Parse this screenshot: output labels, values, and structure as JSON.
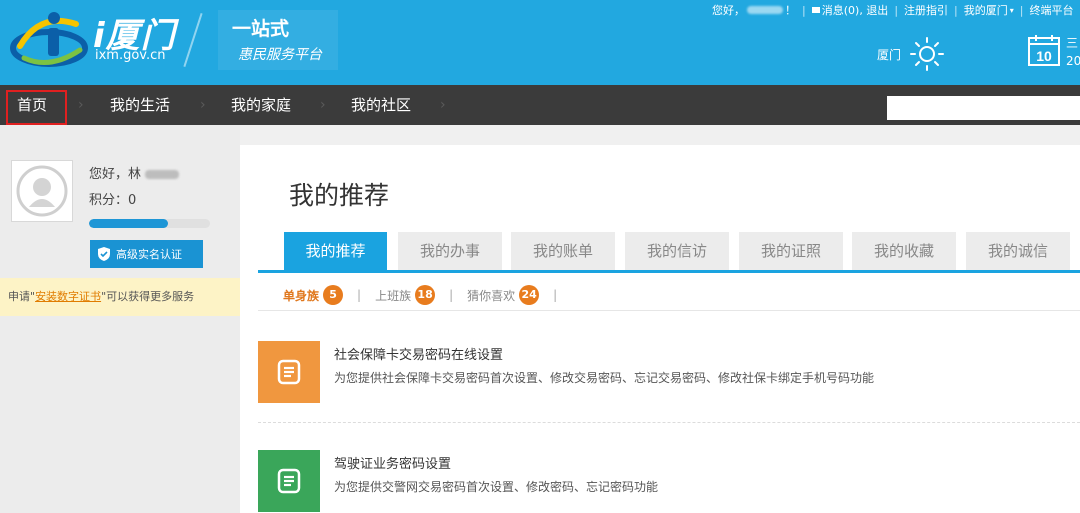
{
  "header": {
    "site_name": "i厦门",
    "site_url": "ixm.gov.cn",
    "slogan_line1": "一站式",
    "slogan_line2": "惠民服务平台",
    "greeting": "您好，",
    "greeting_suffix": "！",
    "messages": "消息(0)",
    "logout": "退出",
    "register_guide": "注册指引",
    "my_xiamen": "我的厦门",
    "terminal": "终端平台",
    "weather_city": "厦门",
    "date_day": "10",
    "date_line1": "三",
    "date_line2": "20"
  },
  "nav": {
    "items": [
      "首页",
      "我的生活",
      "我的家庭",
      "我的社区"
    ],
    "search_placeholder": ""
  },
  "user": {
    "greeting": "您好，林",
    "points": "积分：0",
    "progress": 0.65,
    "verify_label": "高级实名认证"
  },
  "notice": {
    "prefix": "申请\"",
    "link": "安装数字证书",
    "suffix": "\"可以获得更多服务"
  },
  "main": {
    "title": "我的推荐",
    "tabs": [
      "我的推荐",
      "我的办事",
      "我的账单",
      "我的信访",
      "我的证照",
      "我的收藏",
      "我的诚信"
    ],
    "sub_tabs": [
      {
        "label": "单身族",
        "count": "5"
      },
      {
        "label": "上班族",
        "count": "18"
      },
      {
        "label": "猜你喜欢",
        "count": "24"
      }
    ],
    "services": [
      {
        "title": "社会保障卡交易密码在线设置",
        "desc": "为您提供社会保障卡交易密码首次设置、修改交易密码、忘记交易密码、修改社保卡绑定手机号码功能",
        "color": "#f0973f"
      },
      {
        "title": "驾驶证业务密码设置",
        "desc": "为您提供交警网交易密码首次设置、修改密码、忘记密码功能",
        "color": "#3aa65a"
      }
    ]
  },
  "colors": {
    "header_bg": "#22a8e0",
    "nav_bg": "#3b3b3b",
    "accent": "#1aa3e0",
    "badge": "#e87c1e"
  }
}
